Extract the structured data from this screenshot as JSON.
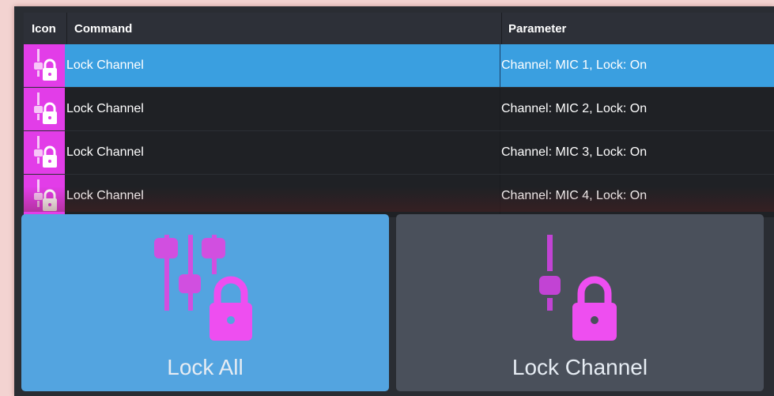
{
  "table": {
    "headers": {
      "icon": "Icon",
      "command": "Command",
      "parameter": "Parameter"
    },
    "rows": [
      {
        "command": "Lock Channel",
        "parameter": "Channel: MIC 1, Lock: On",
        "selected": true
      },
      {
        "command": "Lock Channel",
        "parameter": "Channel: MIC 2, Lock: On",
        "selected": false
      },
      {
        "command": "Lock Channel",
        "parameter": "Channel: MIC 3, Lock: On",
        "selected": false
      },
      {
        "command": "Lock Channel",
        "parameter": "Channel: MIC 4, Lock: On",
        "selected": false
      }
    ],
    "row_icon": "fader-lock-icon"
  },
  "buttons": {
    "lock_all": {
      "label": "Lock All",
      "icon": "faders-lock-icon"
    },
    "lock_channel": {
      "label": "Lock Channel",
      "icon": "fader-lock-icon"
    }
  },
  "colors": {
    "selected_row": "#3a9fe0",
    "icon_magenta": "#e23de8",
    "lock_all_bg": "#53a4e0",
    "lock_channel_bg": "#4a505b"
  }
}
